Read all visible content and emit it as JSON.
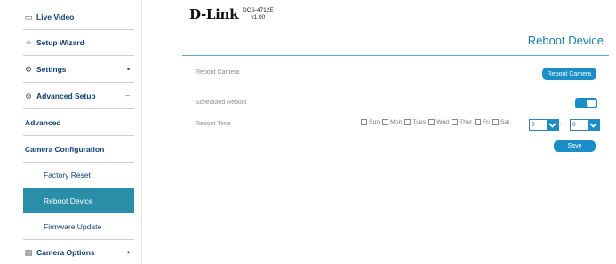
{
  "sidebar": {
    "items": [
      {
        "label": "Live Video",
        "icon": "video-icon",
        "glyph": "▭"
      },
      {
        "label": "Setup Wizard",
        "icon": "wand-icon",
        "glyph": "✧"
      },
      {
        "label": "Settings",
        "icon": "gear-icon",
        "glyph": "⚙",
        "mark": "•"
      },
      {
        "label": "Advanced Setup",
        "icon": "advanced-icon",
        "glyph": "⊛",
        "mark": "–"
      },
      {
        "label": "Advanced"
      },
      {
        "label": "Camera Configuration"
      },
      {
        "label": "Factory Reset"
      },
      {
        "label": "Reboot Device"
      },
      {
        "label": "Firmware Update"
      },
      {
        "label": "Camera Options",
        "icon": "camera-options-icon",
        "glyph": "▤",
        "mark": "•"
      }
    ]
  },
  "header": {
    "brand": "D-Link",
    "model": "DCS-4712E",
    "version": "v1.00"
  },
  "page": {
    "title": "Reboot Device",
    "reboot_camera_label": "Reboot Camera",
    "reboot_camera_button": "Reboot Camera",
    "scheduled_reboot_label": "Scheduled Reboot",
    "scheduled_reboot_on": true,
    "reboot_time_label": "Reboot Time",
    "days": [
      "Sun",
      "Mon",
      "Tues",
      "Wed",
      "Thur",
      "Fri",
      "Sat"
    ],
    "hour_value": "0",
    "time_separator": ":",
    "minute_value": "0",
    "save_button": "Save"
  },
  "colors": {
    "accent": "#1a8fc7",
    "active_nav": "#2a8ea8",
    "title": "#1b7fa8"
  }
}
